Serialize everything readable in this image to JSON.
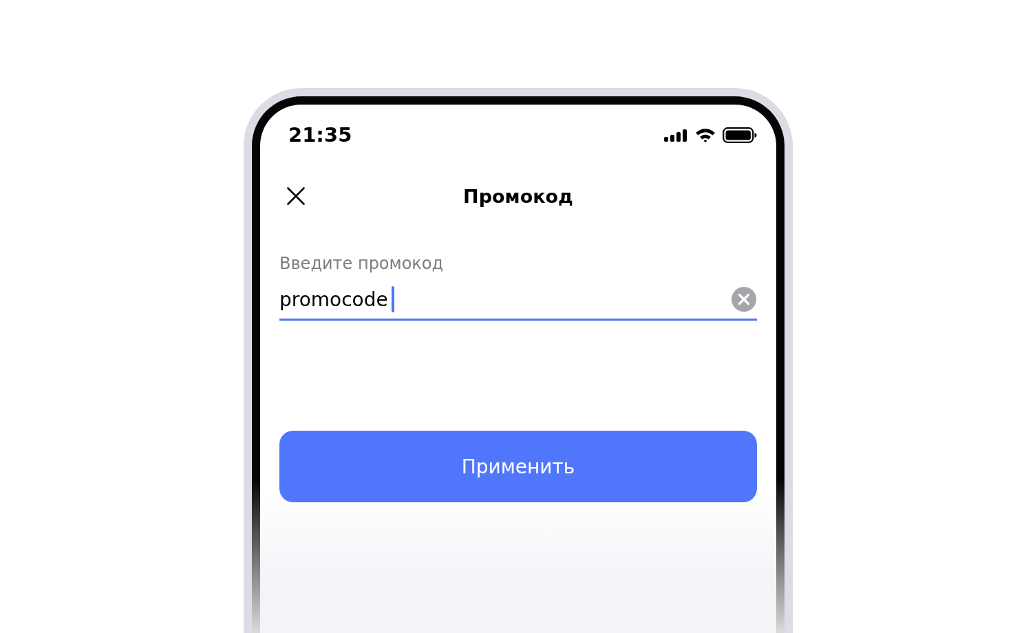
{
  "status_bar": {
    "time": "21:35"
  },
  "header": {
    "title": "Промокод"
  },
  "field": {
    "label": "Введите промокод",
    "value": "promocode",
    "focused": true
  },
  "apply_button": {
    "label": "Применить",
    "disabled": false
  }
}
